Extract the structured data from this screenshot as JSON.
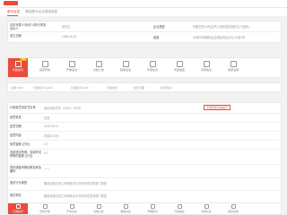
{
  "tabs": [
    {
      "label": "基本信息",
      "active": true
    },
    {
      "label": "风险提示/企业风险信息",
      "active": false
    }
  ],
  "company_info": {
    "rows": [
      {
        "label": "法定代表人/负责人/执行事务合伙人",
        "value": "张先生",
        "label2": "企业类型",
        "value2": "有限责任公司(自然人投资或控股的法人独资)"
      },
      {
        "label": "成立日期",
        "value": "1998-06-18",
        "label2": "经营",
        "value2": "天津市滨海新区(空港经济区)中心大道1号"
      }
    ]
  },
  "menu": {
    "items": [
      {
        "label": "行政处罚",
        "active": true,
        "badge": "100+"
      },
      {
        "label": "经营异常",
        "active": false,
        "badge": ""
      },
      {
        "label": "严重违法",
        "active": false,
        "badge": ""
      },
      {
        "label": "欠税公告",
        "active": false,
        "badge": ""
      },
      {
        "label": "税收违法",
        "active": false,
        "badge": ""
      },
      {
        "label": "环保处罚",
        "active": false,
        "badge": ""
      },
      {
        "label": "司法拍卖",
        "active": false,
        "badge": ""
      },
      {
        "label": "清算信息",
        "active": false,
        "badge": ""
      },
      {
        "label": "简易注销",
        "active": false,
        "badge": ""
      }
    ]
  },
  "filter": {
    "items": [
      "全部 1229",
      "行政处罚 (1229)",
      "行政处罚 1229",
      "行政处罚",
      "处罚日期",
      "处罚机关"
    ]
  },
  "detail": {
    "tag": "不规范处罚的提示",
    "rows": [
      {
        "label": "行政处罚决定书文号",
        "value": "津石西经罚字〔2015〕002号"
      },
      {
        "label": "处罚机关",
        "value": "石西"
      },
      {
        "label": "处罚日期",
        "value": "2015-09-11"
      },
      {
        "label": "处罚内容",
        "value": "罚款2000元"
      },
      {
        "label": "处罚金额 (万元)",
        "value": "0.2"
      },
      {
        "label": "没收违法所得、没收非法财物的金额 (万元)",
        "value": "0.0"
      },
      {
        "label": "暂扣或者吊销证照名称及编号",
        "value": "——"
      },
      {
        "label": "违法行为类型",
        "value": "要求经营石西工商局违法中关系有成员商部门类型"
      },
      {
        "label": "违法事实",
        "value": "要求经营石西工商局违法中关系有成员商部门类型"
      }
    ]
  },
  "footer": {
    "items": [
      {
        "label": "行政处罚",
        "active": true
      },
      {
        "label": "经营异常",
        "active": false
      },
      {
        "label": "严重违法",
        "active": false
      },
      {
        "label": "欠税公告",
        "active": false
      },
      {
        "label": "税收违法",
        "active": false
      },
      {
        "label": "环保处罚",
        "active": false
      },
      {
        "label": "司法拍卖",
        "active": false
      },
      {
        "label": "清算信息",
        "active": false
      },
      {
        "label": "简易注销",
        "active": false
      }
    ]
  },
  "colors": {
    "accent": "#e84c3d",
    "badge": "#f39c12"
  }
}
